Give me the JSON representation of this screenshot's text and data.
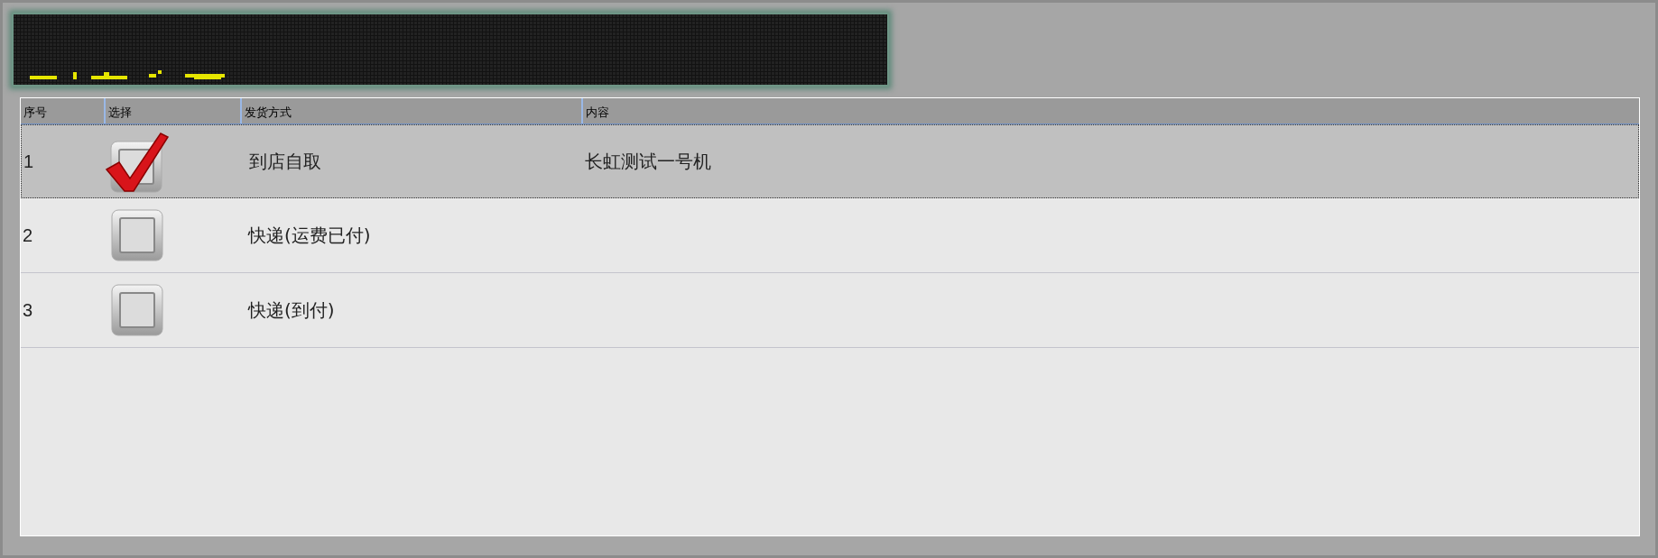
{
  "table": {
    "columns": [
      "序号",
      "选择",
      "发货方式",
      "内容"
    ],
    "rows": [
      {
        "index": "1",
        "checked": true,
        "selected": true,
        "method": "到店自取",
        "content": "长虹测试一号机"
      },
      {
        "index": "2",
        "checked": false,
        "selected": false,
        "method": "快递(运费已付)"
      },
      {
        "index": "3",
        "checked": false,
        "selected": false,
        "method": "快递(到付)"
      }
    ]
  }
}
